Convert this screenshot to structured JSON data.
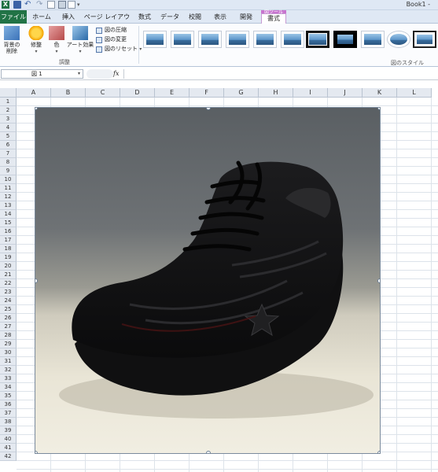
{
  "window": {
    "title": "Book1 -"
  },
  "quick_access": {
    "app_icon": "X",
    "dropdown": "▾"
  },
  "tabs": {
    "file": "ファイル",
    "home": "ホーム",
    "insert": "挿入",
    "layout": "ページ レイアウト",
    "formulas": "数式",
    "data": "データ",
    "review": "校閲",
    "view": "表示",
    "dev": "開発",
    "contextual_label": "図ツール",
    "format": "書式"
  },
  "ribbon": {
    "remove_bg": "背景の削除",
    "corrections": "修整",
    "color": "色",
    "artistic": "アート効果",
    "compress": "図の圧縮",
    "change": "図の変更",
    "reset": "図のリセット",
    "group_adjust": "調整",
    "group_styles": "図のスタイル"
  },
  "formula_bar": {
    "name_box": "図 1",
    "fx": "fx",
    "value": ""
  },
  "columns": [
    "A",
    "B",
    "C",
    "D",
    "E",
    "F",
    "G",
    "H",
    "I",
    "J",
    "K",
    "L"
  ],
  "rows": [
    "1",
    "2",
    "3",
    "4",
    "5",
    "6",
    "7",
    "8",
    "9",
    "10",
    "11",
    "12",
    "13",
    "14",
    "15",
    "16",
    "17",
    "18",
    "19",
    "20",
    "21",
    "22",
    "23",
    "24",
    "25",
    "26",
    "27",
    "28",
    "29",
    "30",
    "31",
    "32",
    "33",
    "34",
    "35",
    "36",
    "37",
    "38",
    "39",
    "40",
    "41",
    "42"
  ],
  "picture": {
    "name": "図 1",
    "subject": "black-sneaker"
  },
  "colors": {
    "file_tab": "#217346",
    "contextual": "#c874cf",
    "accent": "#3b62a6"
  }
}
